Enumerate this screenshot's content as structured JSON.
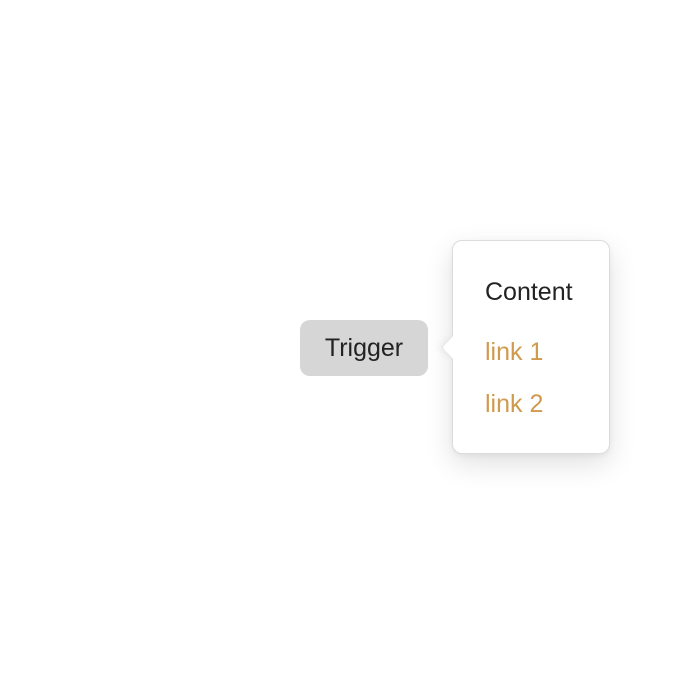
{
  "trigger": {
    "label": "Trigger"
  },
  "popover": {
    "title": "Content",
    "links": [
      {
        "label": "link 1"
      },
      {
        "label": "link 2"
      }
    ]
  },
  "colors": {
    "trigger_bg": "#d6d6d6",
    "link": "#d09a4e",
    "text": "#222222",
    "background": "#ffffff"
  }
}
